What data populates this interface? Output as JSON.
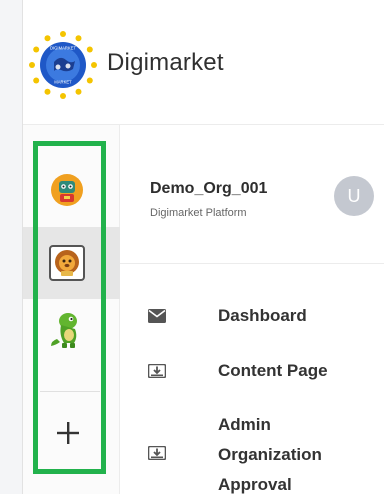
{
  "brand": {
    "name": "Digimarket",
    "logo_icon": "eu-stars-globe-logo-icon",
    "logo_text_top": "DIGIMARKET",
    "logo_text_bottom": "MARKET"
  },
  "org_switcher": {
    "items": [
      {
        "icon": "robot-mascot-icon",
        "selected": false
      },
      {
        "icon": "lion-mascot-icon",
        "selected": true
      },
      {
        "icon": "dinosaur-mascot-icon",
        "selected": false
      }
    ],
    "add_icon": "plus-icon",
    "highlight_color": "#22b24c"
  },
  "organization": {
    "name": "Demo_Org_001",
    "platform": "Digimarket Platform",
    "avatar_initial": "U"
  },
  "nav": {
    "items": [
      {
        "label": "Dashboard",
        "icon": "envelope-icon"
      },
      {
        "label": "Content Page",
        "icon": "download-box-icon"
      },
      {
        "label_lines": [
          "Admin",
          "Organization",
          "Approval"
        ],
        "icon": "download-box-icon"
      }
    ]
  }
}
